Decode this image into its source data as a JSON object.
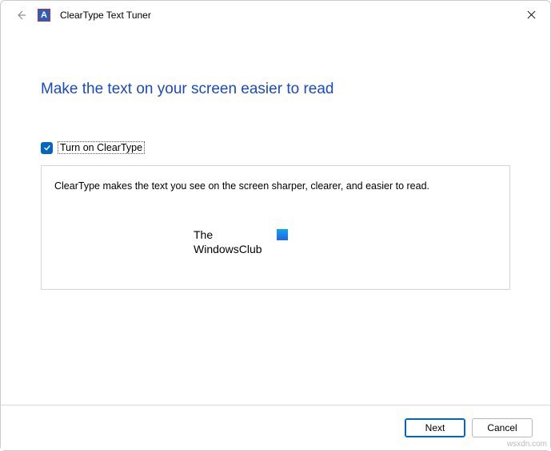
{
  "titlebar": {
    "app_icon_letter": "A",
    "title": "ClearType Text Tuner"
  },
  "heading": "Make the text on your screen easier to read",
  "checkbox": {
    "checked": true,
    "label": "Turn on ClearType"
  },
  "info_box": {
    "text": "ClearType makes the text you see on the screen sharper, clearer, and easier to read."
  },
  "watermark": {
    "line1": "The",
    "line2": "WindowsClub"
  },
  "footer": {
    "next_label": "Next",
    "cancel_label": "Cancel"
  },
  "site_credit": "wsxdn.com"
}
